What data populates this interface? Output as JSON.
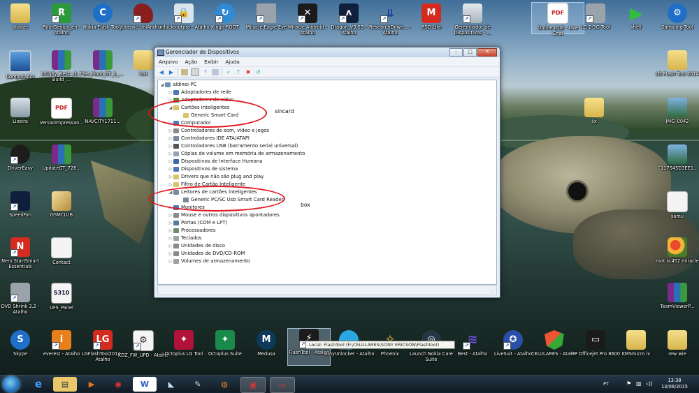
{
  "desktop_icons": {
    "aldinei": "aldinei",
    "rootgenius": "RootGenius_en - Atalho",
    "nokiaflash": "Nokia Flash Tools",
    "jurassic": "Jurassic UniAndroi...",
    "unlockroot": "unlockrootpro - Atalho",
    "kingoroot": "Kingo ROOT",
    "miracleeagle": "Miracle Eagle Eye",
    "miracleandroid": "Miracle Android - Atalho",
    "dragon": "Dragon_V3.53 - Atalho",
    "researchdown": "ResearchDown... - Atalho",
    "rsdlite": "RSD Lite",
    "gerenciador_shortcut": "Gerenciador de Dispositivos - ...",
    "onlinechat": "Online chat - Live Chat",
    "lg2g": "LG 2-3G Tool",
    "shell": "shell",
    "samsungtool": "Samsung Tool",
    "computador": "Computador",
    "infinitybest": "Infinity_Best_v1.7 Build_...",
    "shmoot": "SH_Moot_GT_1_...",
    "loki": "loki",
    "lgflashtool2014": "LG Flash Tool 2014",
    "lixeira": "Lixeira",
    "versaoimpressao": "VersaoImpressao...",
    "navcity": "NAVCITY1711...",
    "jlx": "jlx",
    "img0042": "IMG_0042",
    "drivereasy": "DriverEasy",
    "updategt": "UpdateGT_728...",
    "img_17545": "^117545D3EE1...",
    "speedfan": "SpeedFan",
    "gsmclub": "GSMCLUB",
    "samu": "samu",
    "nero": "Nero StartSmart Essentials",
    "contact": "Contact",
    "rootsc452": "root sc452 miracle",
    "dvdshrink": "DVD Shrink 3.2 - Atalho",
    "ufspanel": "UFS_Panel",
    "teamviewer": "TeamViewerP...",
    "ufs_icon_text": "S310"
  },
  "bottom_icons": {
    "skype": "Skype",
    "everest": "everest - Atalho",
    "lgflashtool2014_atalho": "LGFlashTool2014 - Atalho",
    "kdz": "KDZ_FW_UPD - Atalho",
    "octoplus_lg": "Octoplus LG Tool",
    "octoplus_suite": "Octoplus Suite",
    "medusa": "Medusa",
    "flashtool": "FlashTool - Atalho",
    "sonyunlocker": "SonyUnlocker - Atalho",
    "phoenix": "Phoenix",
    "nokiacare": "Launch Nokia Care Suite",
    "best": "Best - Atalho",
    "livesuit": "LiveSuit - Atalho",
    "celulares": "CELULARES - Atalho",
    "hpofficejet": "HP Officejet Pro 8600",
    "kmsmicro": "KMSmicro iv",
    "rewwie": "rew wie"
  },
  "tooltip": "Local:   FlashTool (F:\\CELULARES\\SONY ERICSON\\Flashtool)",
  "window": {
    "title": "Gerenciador de Dispositivos",
    "controls": {
      "minimize": "–",
      "maximize": "□",
      "close": "✕"
    },
    "menu": [
      "Arquivo",
      "Ação",
      "Exibir",
      "Ajuda"
    ],
    "tree": {
      "root": "aldinei-PC",
      "items": [
        "Adaptadores de rede",
        "Adaptadores de vídeo",
        "Cartões inteligentes",
        "Generic Smart Card",
        "Computador",
        "Controladores de som, vídeo e jogos",
        "Controladores IDE ATA/ATAPI",
        "Controladores USB (barramento serial universal)",
        "Cópias de volume em memória de armazenamento",
        "Dispositivos de Interface Humana",
        "Dispositivos de sistema",
        "Drivers que não são plug and play",
        "Filtro de Cartão Inteligente",
        "Leitores de cartões inteligentes",
        "Generic PC/SC Usb Smart Card Reader",
        "Monitores",
        "Mouse e outros dispositivos apontadores",
        "Portas (COM e LPT)",
        "Processadores",
        "Teclados",
        "Unidades de disco",
        "Unidades de DVD/CD-ROM",
        "Volumes de armazenamento"
      ]
    }
  },
  "annotations": {
    "sincard": "sincard",
    "box": "box"
  },
  "taskbar": {
    "language": "PT",
    "time": "13:38",
    "date": "13/06/2015"
  },
  "colors": {
    "annotation_red": "#e0161c",
    "window_chrome": "#e7eef6"
  }
}
